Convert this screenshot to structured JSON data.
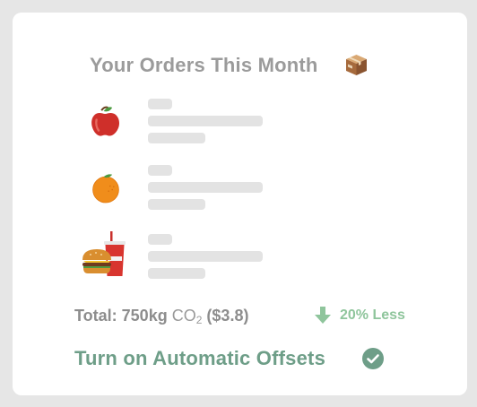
{
  "card": {
    "title": "Your Orders This Month",
    "title_icon": "package-box-icon"
  },
  "orders": [
    {
      "icon": "apple-icon"
    },
    {
      "icon": "orange-icon"
    },
    {
      "icon": "burger-and-drink-icon"
    }
  ],
  "summary": {
    "total_label": "Total: 750kg",
    "co2_label": "CO",
    "co2_subscript": "2",
    "price": "($3.8)",
    "change_text": "20% Less",
    "change_icon": "down-arrow-icon",
    "change_color": "#8fc59c"
  },
  "action": {
    "offsets_label": "Turn on Automatic Offsets",
    "check_icon": "check-circle-icon",
    "color": "#6e9e88"
  }
}
